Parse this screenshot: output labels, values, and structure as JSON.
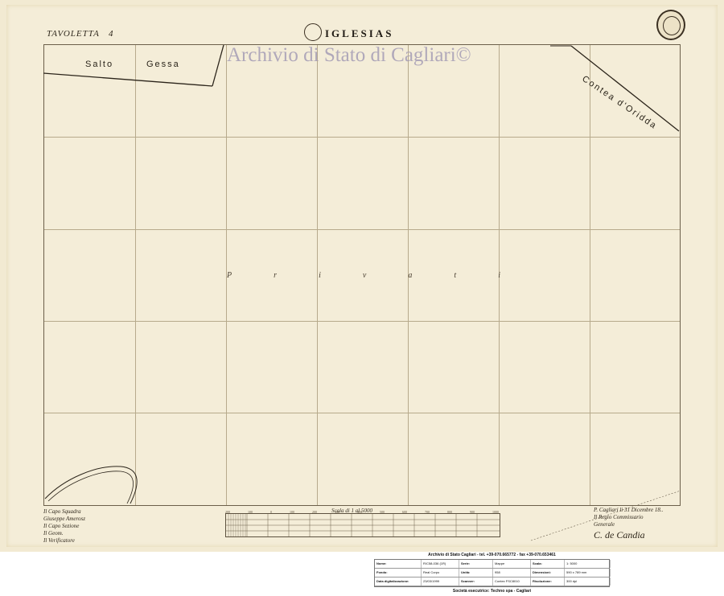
{
  "header": {
    "tavoletta": "TAVOLETTA",
    "tavoletta_number": "4",
    "title": "IGLESIAS"
  },
  "watermark": "Archivio di Stato di Cagliari©",
  "map_labels": {
    "salto": "Salto",
    "gessa": "Gessa",
    "contea": "Contea d'Oridda",
    "privati_letters": [
      "P",
      "r",
      "i",
      "v",
      "a",
      "t",
      "i"
    ]
  },
  "scale": {
    "caption": "Scala di 1 al 5000",
    "ticks": [
      "200",
      "100",
      "0",
      "100",
      "200",
      "300",
      "400",
      "500",
      "600",
      "700",
      "800",
      "900",
      "1000"
    ]
  },
  "handwriting": {
    "left": [
      "Il Capo Squadra",
      "Giuseppe Amerosz",
      "Il Capo Sezione",
      "Il Geom.",
      "Il Verificatore"
    ],
    "right": [
      "P. Cagliari li 31 Dicembre 18..",
      "Il Regio Commissario",
      "Generale",
      "C. de Candia"
    ]
  },
  "info_panel": {
    "header": "Archivio di Stato Cagliari - tel. +39-070.665772 - fax +39-070.653461",
    "rows": [
      [
        {
          "k": "Nome:"
        },
        {
          "v": "R/C58-036 (1R)"
        },
        {
          "k": "Serie:"
        },
        {
          "v": "Mappe"
        },
        {
          "k": "Scala:"
        },
        {
          "v": "1: 5000"
        }
      ],
      [
        {
          "k": "Fondo:"
        },
        {
          "v": "Real Corpo"
        },
        {
          "k": "Unità:"
        },
        {
          "v": "958"
        },
        {
          "k": "Dimensioni:"
        },
        {
          "v": "590 x 789 mm"
        }
      ],
      [
        {
          "k": "Data digitalizzazione:"
        },
        {
          "v": "23/03/1999"
        },
        {
          "k": "Scanner:"
        },
        {
          "v": "Contex FSC8010"
        },
        {
          "k": "Risoluzione:"
        },
        {
          "v": "300 dpi"
        }
      ]
    ],
    "footer": "Società esecutrice: Techno spa - Cagliari"
  }
}
